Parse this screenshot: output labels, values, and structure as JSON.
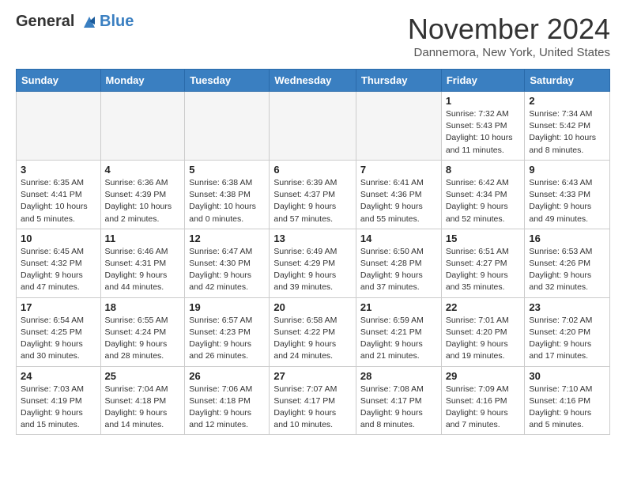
{
  "header": {
    "logo_general": "General",
    "logo_blue": "Blue",
    "month_title": "November 2024",
    "location": "Dannemora, New York, United States"
  },
  "days_of_week": [
    "Sunday",
    "Monday",
    "Tuesday",
    "Wednesday",
    "Thursday",
    "Friday",
    "Saturday"
  ],
  "weeks": [
    [
      {
        "day": "",
        "info": "",
        "empty": true
      },
      {
        "day": "",
        "info": "",
        "empty": true
      },
      {
        "day": "",
        "info": "",
        "empty": true
      },
      {
        "day": "",
        "info": "",
        "empty": true
      },
      {
        "day": "",
        "info": "",
        "empty": true
      },
      {
        "day": "1",
        "info": "Sunrise: 7:32 AM\nSunset: 5:43 PM\nDaylight: 10 hours and 11 minutes."
      },
      {
        "day": "2",
        "info": "Sunrise: 7:34 AM\nSunset: 5:42 PM\nDaylight: 10 hours and 8 minutes."
      }
    ],
    [
      {
        "day": "3",
        "info": "Sunrise: 6:35 AM\nSunset: 4:41 PM\nDaylight: 10 hours and 5 minutes."
      },
      {
        "day": "4",
        "info": "Sunrise: 6:36 AM\nSunset: 4:39 PM\nDaylight: 10 hours and 2 minutes."
      },
      {
        "day": "5",
        "info": "Sunrise: 6:38 AM\nSunset: 4:38 PM\nDaylight: 10 hours and 0 minutes."
      },
      {
        "day": "6",
        "info": "Sunrise: 6:39 AM\nSunset: 4:37 PM\nDaylight: 9 hours and 57 minutes."
      },
      {
        "day": "7",
        "info": "Sunrise: 6:41 AM\nSunset: 4:36 PM\nDaylight: 9 hours and 55 minutes."
      },
      {
        "day": "8",
        "info": "Sunrise: 6:42 AM\nSunset: 4:34 PM\nDaylight: 9 hours and 52 minutes."
      },
      {
        "day": "9",
        "info": "Sunrise: 6:43 AM\nSunset: 4:33 PM\nDaylight: 9 hours and 49 minutes."
      }
    ],
    [
      {
        "day": "10",
        "info": "Sunrise: 6:45 AM\nSunset: 4:32 PM\nDaylight: 9 hours and 47 minutes."
      },
      {
        "day": "11",
        "info": "Sunrise: 6:46 AM\nSunset: 4:31 PM\nDaylight: 9 hours and 44 minutes."
      },
      {
        "day": "12",
        "info": "Sunrise: 6:47 AM\nSunset: 4:30 PM\nDaylight: 9 hours and 42 minutes."
      },
      {
        "day": "13",
        "info": "Sunrise: 6:49 AM\nSunset: 4:29 PM\nDaylight: 9 hours and 39 minutes."
      },
      {
        "day": "14",
        "info": "Sunrise: 6:50 AM\nSunset: 4:28 PM\nDaylight: 9 hours and 37 minutes."
      },
      {
        "day": "15",
        "info": "Sunrise: 6:51 AM\nSunset: 4:27 PM\nDaylight: 9 hours and 35 minutes."
      },
      {
        "day": "16",
        "info": "Sunrise: 6:53 AM\nSunset: 4:26 PM\nDaylight: 9 hours and 32 minutes."
      }
    ],
    [
      {
        "day": "17",
        "info": "Sunrise: 6:54 AM\nSunset: 4:25 PM\nDaylight: 9 hours and 30 minutes."
      },
      {
        "day": "18",
        "info": "Sunrise: 6:55 AM\nSunset: 4:24 PM\nDaylight: 9 hours and 28 minutes."
      },
      {
        "day": "19",
        "info": "Sunrise: 6:57 AM\nSunset: 4:23 PM\nDaylight: 9 hours and 26 minutes."
      },
      {
        "day": "20",
        "info": "Sunrise: 6:58 AM\nSunset: 4:22 PM\nDaylight: 9 hours and 24 minutes."
      },
      {
        "day": "21",
        "info": "Sunrise: 6:59 AM\nSunset: 4:21 PM\nDaylight: 9 hours and 21 minutes."
      },
      {
        "day": "22",
        "info": "Sunrise: 7:01 AM\nSunset: 4:20 PM\nDaylight: 9 hours and 19 minutes."
      },
      {
        "day": "23",
        "info": "Sunrise: 7:02 AM\nSunset: 4:20 PM\nDaylight: 9 hours and 17 minutes."
      }
    ],
    [
      {
        "day": "24",
        "info": "Sunrise: 7:03 AM\nSunset: 4:19 PM\nDaylight: 9 hours and 15 minutes."
      },
      {
        "day": "25",
        "info": "Sunrise: 7:04 AM\nSunset: 4:18 PM\nDaylight: 9 hours and 14 minutes."
      },
      {
        "day": "26",
        "info": "Sunrise: 7:06 AM\nSunset: 4:18 PM\nDaylight: 9 hours and 12 minutes."
      },
      {
        "day": "27",
        "info": "Sunrise: 7:07 AM\nSunset: 4:17 PM\nDaylight: 9 hours and 10 minutes."
      },
      {
        "day": "28",
        "info": "Sunrise: 7:08 AM\nSunset: 4:17 PM\nDaylight: 9 hours and 8 minutes."
      },
      {
        "day": "29",
        "info": "Sunrise: 7:09 AM\nSunset: 4:16 PM\nDaylight: 9 hours and 7 minutes."
      },
      {
        "day": "30",
        "info": "Sunrise: 7:10 AM\nSunset: 4:16 PM\nDaylight: 9 hours and 5 minutes."
      }
    ]
  ]
}
